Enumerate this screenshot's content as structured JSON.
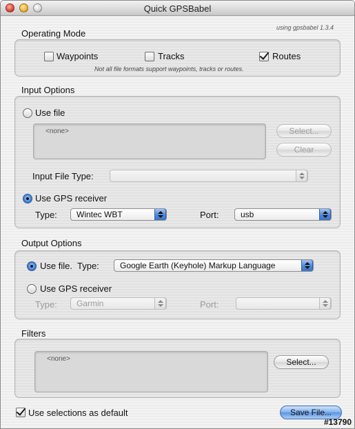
{
  "window": {
    "title": "Quick GPSBabel",
    "version_text": "using gpsbabel 1.3.4"
  },
  "operating_mode": {
    "label": "Operating Mode",
    "waypoints": {
      "label": "Waypoints",
      "checked": false
    },
    "tracks": {
      "label": "Tracks",
      "checked": false
    },
    "routes": {
      "label": "Routes",
      "checked": true
    },
    "note": "Not all file formats support waypoints, tracks or routes."
  },
  "input_options": {
    "label": "Input Options",
    "use_file_label": "Use file",
    "file_value": "<none>",
    "select_button": "Select...",
    "clear_button": "Clear",
    "input_file_type_label": "Input File Type:",
    "input_file_type_value": "",
    "use_gps_label": "Use GPS receiver",
    "type_label": "Type:",
    "type_value": "Wintec WBT",
    "port_label": "Port:",
    "port_value": "usb"
  },
  "output_options": {
    "label": "Output Options",
    "use_file_label": "Use file.",
    "type_label": "Type:",
    "type_value": "Google Earth (Keyhole) Markup Language",
    "use_gps_label": "Use GPS receiver",
    "gps_type_label": "Type:",
    "gps_type_value": "Garmin",
    "port_label": "Port:",
    "port_value": ""
  },
  "filters": {
    "label": "Filters",
    "value": "<none>",
    "select_button": "Select..."
  },
  "footer": {
    "default_label": "Use selections as default",
    "default_checked": true,
    "save_button": "Save File...",
    "watermark": "#13790"
  },
  "colors": {
    "accent": "#4f88d8",
    "window_bg": "#ececec"
  }
}
